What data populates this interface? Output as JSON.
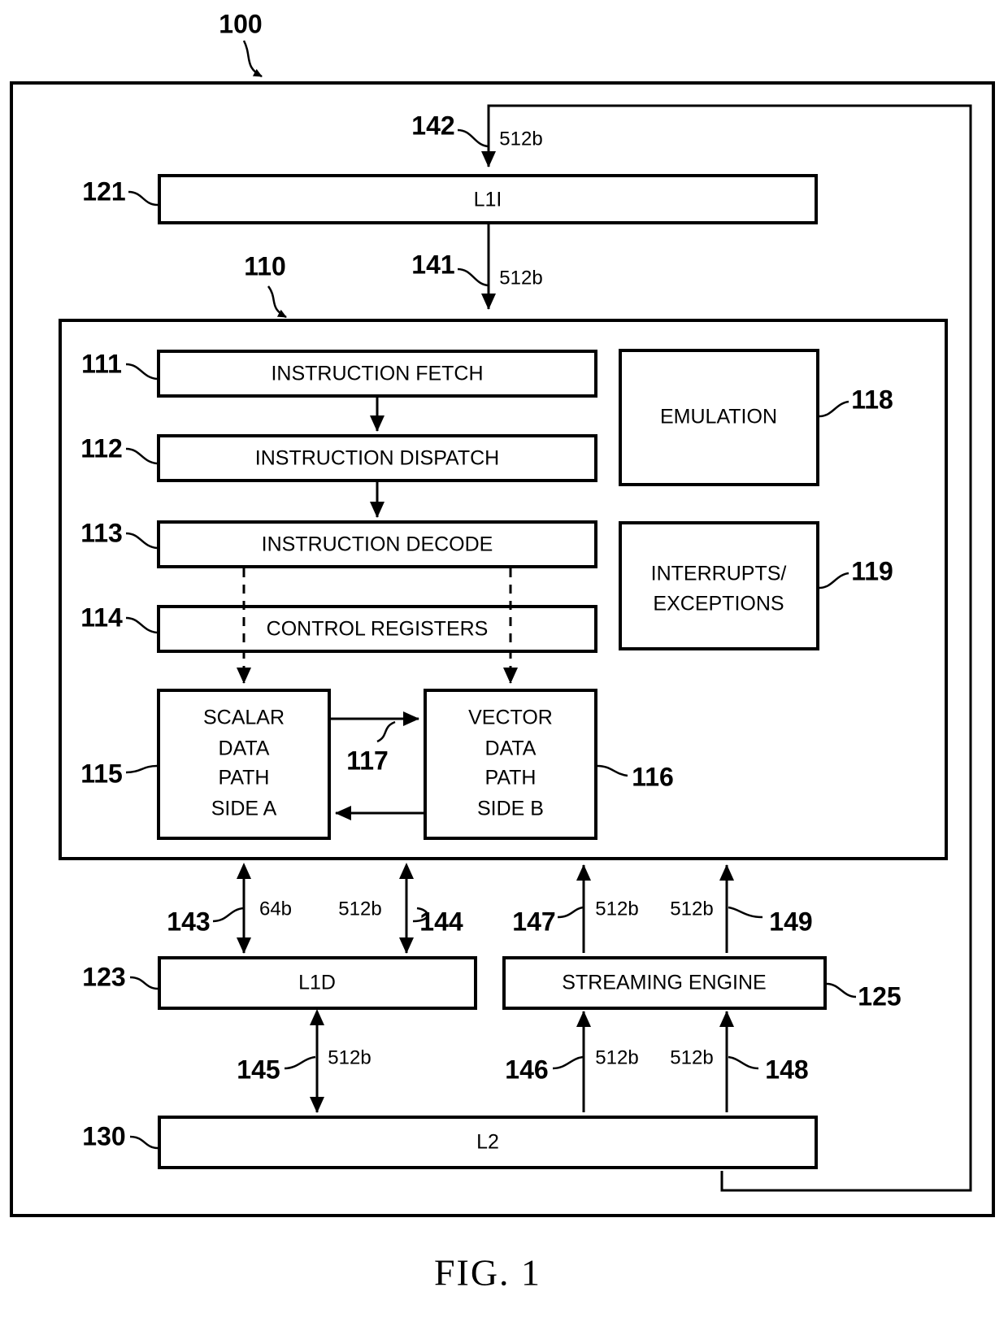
{
  "figure": {
    "caption": "FIG. 1",
    "system_ref": "100",
    "boxes": {
      "l1i": {
        "label": "L1I",
        "ref": "121"
      },
      "cpu": {
        "ref": "110"
      },
      "instruction_fetch": {
        "label": "INSTRUCTION FETCH",
        "ref": "111"
      },
      "instruction_dispatch": {
        "label": "INSTRUCTION DISPATCH",
        "ref": "112"
      },
      "instruction_decode": {
        "label": "INSTRUCTION DECODE",
        "ref": "113"
      },
      "control_registers": {
        "label": "CONTROL REGISTERS",
        "ref": "114"
      },
      "scalar_datapath": {
        "lines": [
          "SCALAR",
          "DATA",
          "PATH",
          "SIDE A"
        ],
        "ref": "115"
      },
      "vector_datapath": {
        "lines": [
          "VECTOR",
          "DATA",
          "PATH",
          "SIDE B"
        ],
        "ref": "116"
      },
      "emulation": {
        "label": "EMULATION",
        "ref": "118"
      },
      "interrupts_exceptions": {
        "lines": [
          "INTERRUPTS/",
          "EXCEPTIONS"
        ],
        "ref": "119"
      },
      "l1d": {
        "label": "L1D",
        "ref": "123"
      },
      "streaming_engine": {
        "label": "STREAMING ENGINE",
        "ref": "125"
      },
      "l2": {
        "label": "L2",
        "ref": "130"
      }
    },
    "buses": [
      {
        "ref": "142",
        "width": "512b"
      },
      {
        "ref": "141",
        "width": "512b"
      },
      {
        "ref": "143",
        "width": "64b"
      },
      {
        "ref": "144",
        "width": "512b"
      },
      {
        "ref": "147",
        "width": "512b"
      },
      {
        "ref": "149",
        "width": "512b"
      },
      {
        "ref": "145",
        "width": "512b"
      },
      {
        "ref": "146",
        "width": "512b"
      },
      {
        "ref": "148",
        "width": "512b"
      }
    ],
    "crossbar": {
      "ref": "117"
    }
  }
}
